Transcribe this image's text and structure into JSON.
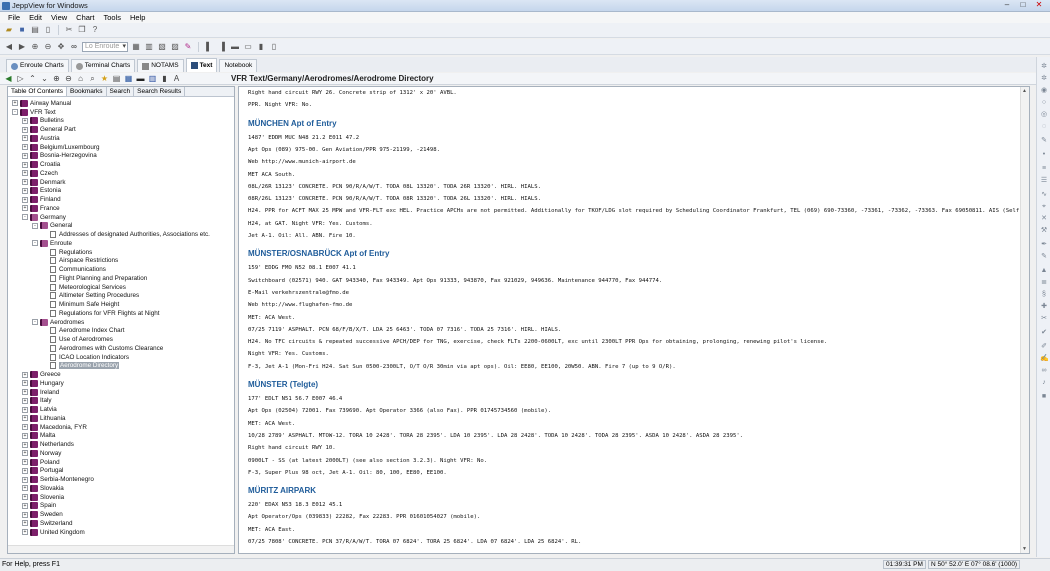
{
  "window": {
    "title": "JeppView for Windows",
    "minimize": "–",
    "maximize": "□",
    "close": "✕"
  },
  "menu": [
    "File",
    "Edit",
    "View",
    "Chart",
    "Tools",
    "Help"
  ],
  "toolbar": {
    "route_placeholder": "Lo Enroute"
  },
  "tabs": [
    "Enroute Charts",
    "Terminal Charts",
    "NOTAMS",
    "Text",
    "Notebook"
  ],
  "doc_path": "VFR Text/Germany/Aerodromes/Aerodrome Directory",
  "left_tabs": [
    "Table Of Contents",
    "Bookmarks",
    "Search",
    "Search Results"
  ],
  "tree": [
    {
      "d": 0,
      "t": "Airway Manual",
      "k": "book",
      "e": "+"
    },
    {
      "d": 0,
      "t": "VFR Text",
      "k": "book",
      "e": "-"
    },
    {
      "d": 1,
      "t": "Bulletins",
      "k": "book",
      "e": "+"
    },
    {
      "d": 1,
      "t": "General Part",
      "k": "book",
      "e": "+"
    },
    {
      "d": 1,
      "t": "Austria",
      "k": "book",
      "e": "+"
    },
    {
      "d": 1,
      "t": "Belgium/Luxembourg",
      "k": "book",
      "e": "+"
    },
    {
      "d": 1,
      "t": "Bosnia-Herzegovina",
      "k": "book",
      "e": "+"
    },
    {
      "d": 1,
      "t": "Croatia",
      "k": "book",
      "e": "+"
    },
    {
      "d": 1,
      "t": "Czech",
      "k": "book",
      "e": "+"
    },
    {
      "d": 1,
      "t": "Denmark",
      "k": "book",
      "e": "+"
    },
    {
      "d": 1,
      "t": "Estonia",
      "k": "book",
      "e": "+"
    },
    {
      "d": 1,
      "t": "Finland",
      "k": "book",
      "e": "+"
    },
    {
      "d": 1,
      "t": "France",
      "k": "book",
      "e": "+"
    },
    {
      "d": 1,
      "t": "Germany",
      "k": "open",
      "e": "-"
    },
    {
      "d": 2,
      "t": "General",
      "k": "open",
      "e": "-"
    },
    {
      "d": 3,
      "t": "Addresses of designated Authorities, Associations etc.",
      "k": "page",
      "e": ""
    },
    {
      "d": 2,
      "t": "Enroute",
      "k": "open",
      "e": "-"
    },
    {
      "d": 3,
      "t": "Regulations",
      "k": "page",
      "e": ""
    },
    {
      "d": 3,
      "t": "Airspace Restrictions",
      "k": "page",
      "e": ""
    },
    {
      "d": 3,
      "t": "Communications",
      "k": "page",
      "e": ""
    },
    {
      "d": 3,
      "t": "Flight Planning and Preparation",
      "k": "page",
      "e": ""
    },
    {
      "d": 3,
      "t": "Meteorological Services",
      "k": "page",
      "e": ""
    },
    {
      "d": 3,
      "t": "Altimeter Setting Procedures",
      "k": "page",
      "e": ""
    },
    {
      "d": 3,
      "t": "Minimum Safe Height",
      "k": "page",
      "e": ""
    },
    {
      "d": 3,
      "t": "Regulations for VFR Flights at Night",
      "k": "page",
      "e": ""
    },
    {
      "d": 2,
      "t": "Aerodromes",
      "k": "open",
      "e": "-"
    },
    {
      "d": 3,
      "t": "Aerodrome Index Chart",
      "k": "page",
      "e": ""
    },
    {
      "d": 3,
      "t": "Use of Aerodromes",
      "k": "page",
      "e": ""
    },
    {
      "d": 3,
      "t": "Aerodromes with Customs Clearance",
      "k": "page",
      "e": ""
    },
    {
      "d": 3,
      "t": "ICAO Location Indicators",
      "k": "page",
      "e": ""
    },
    {
      "d": 3,
      "t": "Aerodrome Directory",
      "k": "page",
      "e": "",
      "sel": true
    },
    {
      "d": 1,
      "t": "Greece",
      "k": "book",
      "e": "+"
    },
    {
      "d": 1,
      "t": "Hungary",
      "k": "book",
      "e": "+"
    },
    {
      "d": 1,
      "t": "Ireland",
      "k": "book",
      "e": "+"
    },
    {
      "d": 1,
      "t": "Italy",
      "k": "book",
      "e": "+"
    },
    {
      "d": 1,
      "t": "Latvia",
      "k": "book",
      "e": "+"
    },
    {
      "d": 1,
      "t": "Lithuania",
      "k": "book",
      "e": "+"
    },
    {
      "d": 1,
      "t": "Macedonia, FYR",
      "k": "book",
      "e": "+"
    },
    {
      "d": 1,
      "t": "Malta",
      "k": "book",
      "e": "+"
    },
    {
      "d": 1,
      "t": "Netherlands",
      "k": "book",
      "e": "+"
    },
    {
      "d": 1,
      "t": "Norway",
      "k": "book",
      "e": "+"
    },
    {
      "d": 1,
      "t": "Poland",
      "k": "book",
      "e": "+"
    },
    {
      "d": 1,
      "t": "Portugal",
      "k": "book",
      "e": "+"
    },
    {
      "d": 1,
      "t": "Serbia-Montenegro",
      "k": "book",
      "e": "+"
    },
    {
      "d": 1,
      "t": "Slovakia",
      "k": "book",
      "e": "+"
    },
    {
      "d": 1,
      "t": "Slovenia",
      "k": "book",
      "e": "+"
    },
    {
      "d": 1,
      "t": "Spain",
      "k": "book",
      "e": "+"
    },
    {
      "d": 1,
      "t": "Sweden",
      "k": "book",
      "e": "+"
    },
    {
      "d": 1,
      "t": "Switzerland",
      "k": "book",
      "e": "+"
    },
    {
      "d": 1,
      "t": "United Kingdom",
      "k": "book",
      "e": "+"
    }
  ],
  "doc": [
    {
      "h": false,
      "t": "Right hand circuit RWY 26. Concrete strip of 1312' x 20' AVBL."
    },
    {
      "h": false,
      "t": "PPR. Night VFR: No."
    },
    {
      "h": true,
      "t": "MÜNCHEN Apt of Entry"
    },
    {
      "h": false,
      "t": "1487' EDDM MUC N48 21.2 E011 47.2"
    },
    {
      "h": false,
      "t": "Apt Ops (089) 975-00. Gen Aviation/PPR 975-21199, -21498."
    },
    {
      "h": false,
      "t": "Web http://www.munich-airport.de"
    },
    {
      "h": false,
      "t": "MET ACA South."
    },
    {
      "h": false,
      "t": "08L/26R 13123' CONCRETE. PCN 90/R/A/W/T. TODA 08L 13320'. TODA 26R 13320'. HIRL. HIALS."
    },
    {
      "h": false,
      "t": "08R/26L 13123' CONCRETE. PCN 90/R/A/W/T. TODA 08R 13320'. TODA 26L 13320'. HIRL. HIALS."
    },
    {
      "h": false,
      "t": "H24. PPR for ACFT MAX 25 MPW and VFR-FLT exc HEL. Practice APCHs are not permitted. Additionally for TKOF/LDG slot required by Scheduling Coordinator Frankfurt, TEL (069) 690-73360, -73361, -73362, -73363. Fax 69050811. AIS (Self-briefing)"
    },
    {
      "h": false,
      "t": "H24, at GAT. Night VFR: Yes. Customs."
    },
    {
      "h": false,
      "t": "Jet A-1. Oil: All. ABN. Fire 10."
    },
    {
      "h": true,
      "t": "MÜNSTER/OSNABRÜCK Apt of Entry"
    },
    {
      "h": false,
      "t": "159' EDDG FMO N52 08.1 E007 41.1"
    },
    {
      "h": false,
      "t": "Switchboard (02571) 940. GAT 943340, Fax 943349. Apt Ops 91333, 943870, Fax 921029, 949636. Maintenance 944770, Fax 944774."
    },
    {
      "h": false,
      "t": "E-Mail verkehrszentrale@fmo.de"
    },
    {
      "h": false,
      "t": "Web http://www.flughafen-fmo.de"
    },
    {
      "h": false,
      "t": "MET: ACA West."
    },
    {
      "h": false,
      "t": "07/25 7119' ASPHALT. PCN 68/F/B/X/T. LDA 25 6463'. TODA 07 7316'. TODA 25 7316'. HIRL. HIALS."
    },
    {
      "h": false,
      "t": "H24. No TFC circuits & repeated successive APCH/DEP for TNG, exercise, check FLTs 2200-0600LT, exc until 2300LT PPR Ops for obtaining, prolonging, renewing pilot's license."
    },
    {
      "h": false,
      "t": "Night VFR: Yes. Customs."
    },
    {
      "h": false,
      "t": "F-3, Jet A-1 (Mon-Fri H24. Sat Sun 0500-2300LT, O/T O/R 30min via apt ops). Oil: EE80, EE100, 20W50. ABN. Fire 7 (up to 9 O/R)."
    },
    {
      "h": true,
      "t": "MÜNSTER (Telgte)"
    },
    {
      "h": false,
      "t": "177' EDLT N51 56.7 E007 46.4"
    },
    {
      "h": false,
      "t": "Apt Ops (02504) 72001. Fax 739690. Apt Operator 3366 (also Fax). PPR 01745734560 (mobile)."
    },
    {
      "h": false,
      "t": "MET: ACA West."
    },
    {
      "h": false,
      "t": "10/28 2789' ASPHALT. MTOW-12. TORA 10 2428'. TORA 28 2395'. LDA 10 2395'. LDA 28 2428'. TODA 10 2428'. TODA 28 2395'. ASDA 10 2428'. ASDA 28 2395'."
    },
    {
      "h": false,
      "t": "Right hand circuit RWY 10."
    },
    {
      "h": false,
      "t": "0900LT - SS (at latest 2000LT) (see also section 3.2.3). Night VFR: No."
    },
    {
      "h": false,
      "t": "F-3, Super Plus 98 oct, Jet A-1. Oil: 80, 100, EE80, EE100."
    },
    {
      "h": true,
      "t": "MÜRITZ AIRPARK"
    },
    {
      "h": false,
      "t": "220' EDAX N53 18.3 E012 45.1"
    },
    {
      "h": false,
      "t": "Apt Operator/Ops (039833) 22282, Fax 22283. PPR 01601054027 (mobile)."
    },
    {
      "h": false,
      "t": "MET: ACA East."
    },
    {
      "h": false,
      "t": "07/25 7808' CONCRETE. PCN 37/R/A/W/T. TORA 07 6824'. TORA 25 6824'. LDA 07 6824'. LDA 25 6824'. RL."
    }
  ],
  "status": {
    "hint": "For Help, press F1",
    "time": "01:39:31 PM",
    "coords": "N 50° 52.0' E 07° 08.6' (1000)"
  }
}
